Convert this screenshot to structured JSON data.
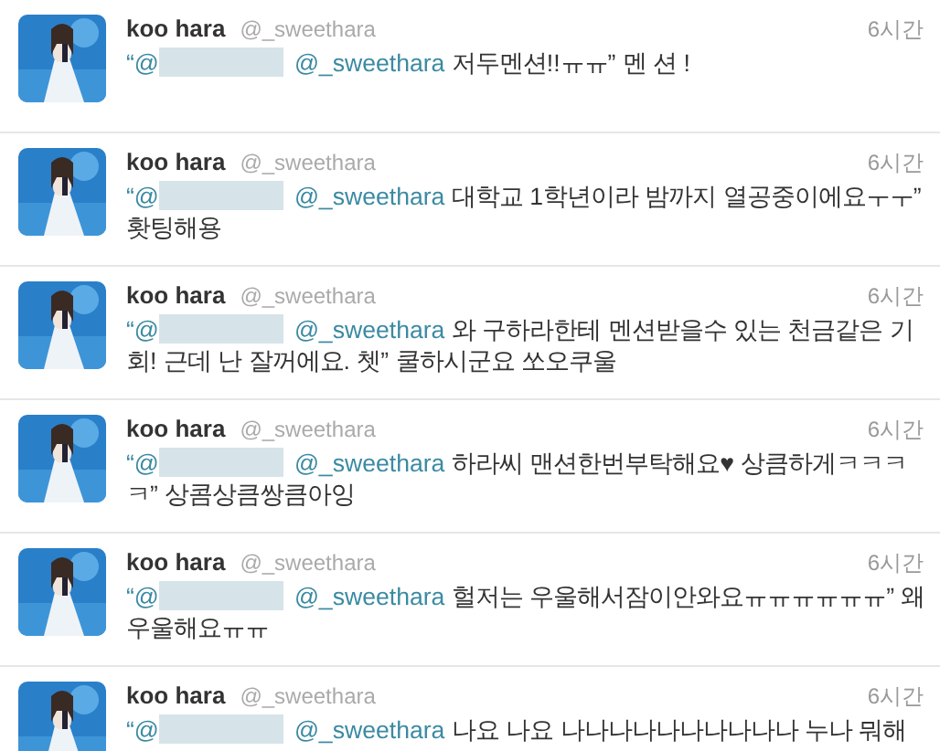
{
  "tweets": [
    {
      "name": "koo hara",
      "handle": "@_sweethara",
      "time": "6시간",
      "prefix": "“@",
      "mention": "@_sweethara",
      "body": "저두멘션!!ㅠㅠ” 멘 션 !"
    },
    {
      "name": "koo hara",
      "handle": "@_sweethara",
      "time": "6시간",
      "prefix": "“@",
      "mention": "@_sweethara",
      "body": "대학교 1학년이라 밤까지 열공중이에요ㅜㅜ” 홧팅해용"
    },
    {
      "name": "koo hara",
      "handle": "@_sweethara",
      "time": "6시간",
      "prefix": "“@",
      "mention": "@_sweethara",
      "body": "와 구하라한테 멘션받을수 있는 천금같은 기회! 근데 난 잘꺼에요. 쳇” 쿨하시군요 쏘오쿠울"
    },
    {
      "name": "koo hara",
      "handle": "@_sweethara",
      "time": "6시간",
      "prefix": "“@",
      "mention": "@_sweethara",
      "body": "하라씨 맨션한번부탁해요♥ 상큼하게ㅋㅋㅋㅋ” 상콤상큼쌍큼아잉"
    },
    {
      "name": "koo hara",
      "handle": "@_sweethara",
      "time": "6시간",
      "prefix": "“@",
      "mention": "@_sweethara",
      "body": "헐저는 우울해서잠이안와요ㅠㅠㅠㅠㅠㅠ” 왜우울해요ㅠㅠ"
    },
    {
      "name": "koo hara",
      "handle": "@_sweethara",
      "time": "6시간",
      "prefix": "“@",
      "mention": "@_sweethara",
      "body": "나요 나요 나나나나나나나나나나 누나 뭐해"
    }
  ]
}
